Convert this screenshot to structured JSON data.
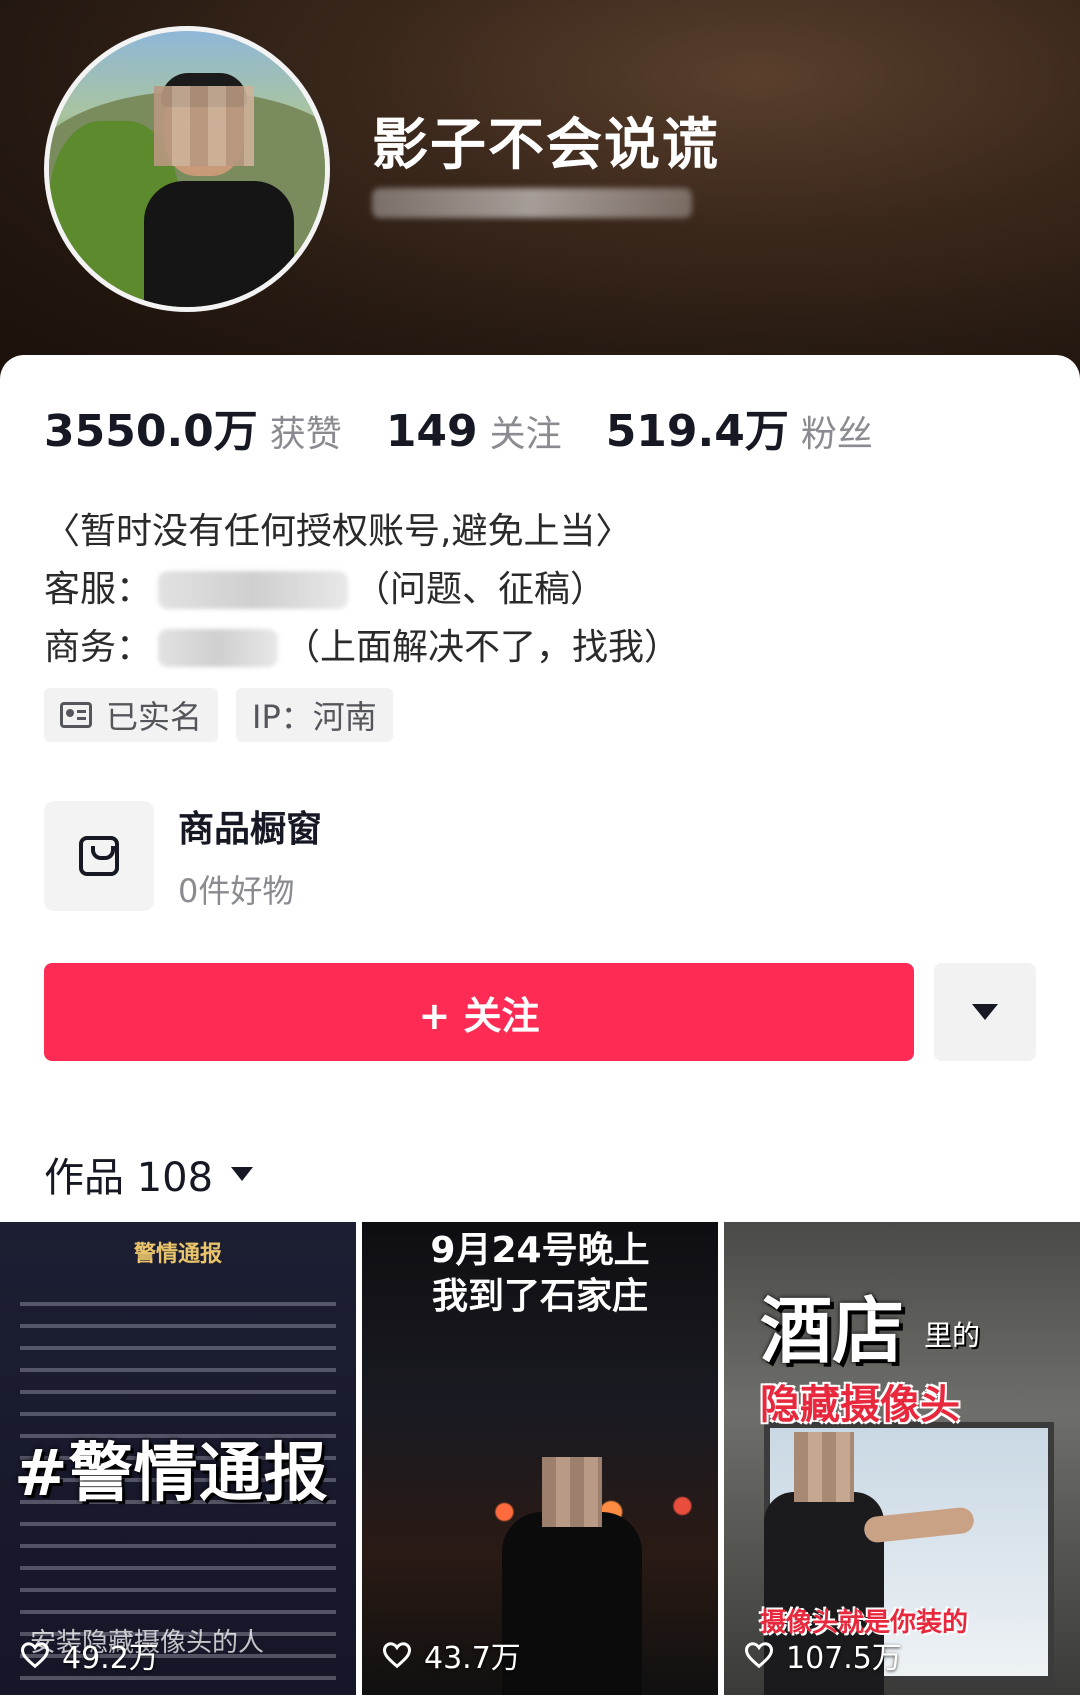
{
  "profile": {
    "username": "影子不会说谎"
  },
  "stats": [
    {
      "value": "3550.0万",
      "label": "获赞"
    },
    {
      "value": "149",
      "label": "关注"
    },
    {
      "value": "519.4万",
      "label": "粉丝"
    }
  ],
  "bio": {
    "line1": "〈暂时没有任何授权账号,避免上当〉",
    "service_label": "客服：",
    "service_note": "（问题、征稿）",
    "business_label": "商务：",
    "business_note": "（上面解决不了，找我）"
  },
  "tags": {
    "verified": "已实名",
    "ip": "IP：河南"
  },
  "shop": {
    "title": "商品橱窗",
    "subtitle": "0件好物"
  },
  "actions": {
    "follow_label": "+ 关注"
  },
  "works": {
    "label": "作品 108"
  },
  "videos": [
    {
      "likes": "49.2万",
      "header": "警情通报",
      "overlay": "#警情通报",
      "caption": "安装隐藏摄像头的人"
    },
    {
      "likes": "43.7万",
      "overlay_line1": "9月24号晚上",
      "overlay_line2": "我到了石家庄"
    },
    {
      "likes": "107.5万",
      "overlay_big": "酒店",
      "overlay_small": "里的",
      "overlay_red": "隐藏摄像头",
      "caption": "摄像头就是你装的"
    }
  ],
  "colors": {
    "accent": "#fe2c55",
    "text_primary": "#161823",
    "text_secondary": "#8a8b91"
  }
}
